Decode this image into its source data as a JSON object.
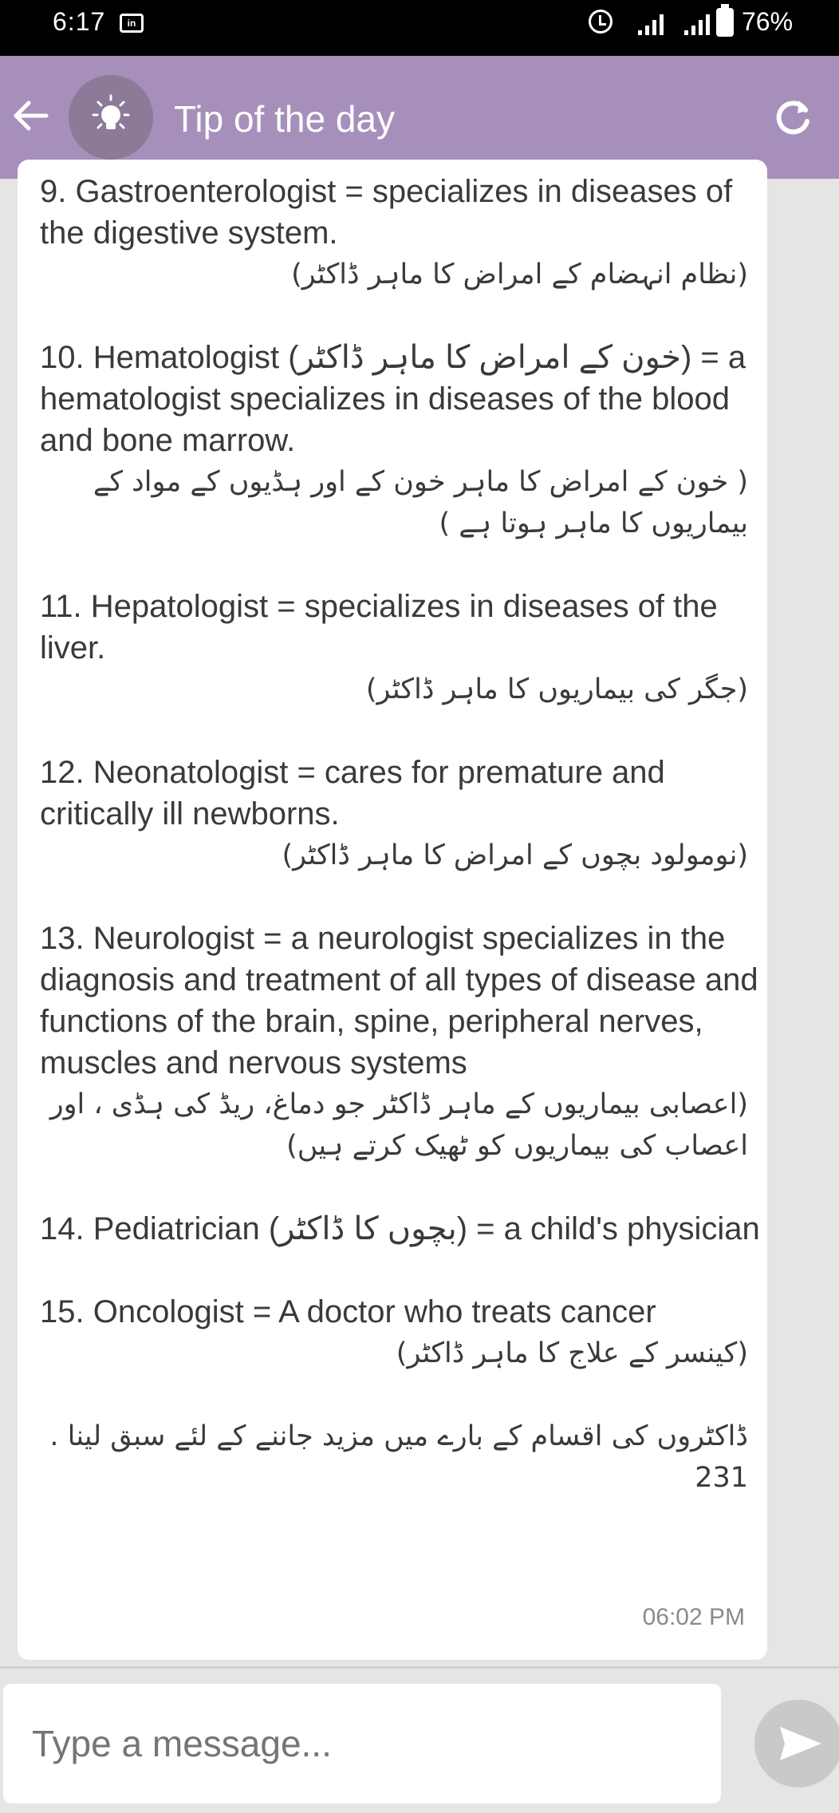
{
  "status_bar": {
    "time": "6:17",
    "battery": "76%",
    "app_icon_text": "in"
  },
  "app_bar": {
    "title": "Tip of the day",
    "back_icon": "arrow-left-icon",
    "avatar_icon": "lightbulb-icon",
    "refresh_icon": "refresh-icon",
    "color": "#a68fba"
  },
  "message": {
    "entries": [
      {
        "en": "9. Gastroenterologist =  specializes in diseases of the digestive system.",
        "ur": "(نظام انہضام کے امراض کا ماہر ڈاکٹر)"
      },
      {
        "en": "10. Hematologist (خون کے امراض کا ماہر ڈاکٹر) = a hematologist specializes in diseases of the blood and bone marrow.",
        "ur": "( خون کے امراض کا ماہر خون کے اور ہڈیوں کے مواد کے بیماریوں کا ماہر ہوتا ہے )"
      },
      {
        "en": "11. Hepatologist = specializes in diseases of the liver.",
        "ur": "(جگر کی بیماریوں کا ماہر ڈاکٹر)"
      },
      {
        "en": "12. Neonatologist = cares for premature and critically ill newborns.",
        "ur": "(نومولود بچوں کے امراض کا ماہر ڈاکٹر)"
      },
      {
        "en": "13. Neurologist = a neurologist specializes in the diagnosis and treatment of all types of disease and functions of the brain, spine, peripheral nerves, muscles and nervous systems",
        "ur": "(اعصابی بیماریوں کے  ماہر ڈاکٹر جو دماغ، ریڈ کی ہڈی ، اور اعصاب کی بیماریوں کو ٹھیک کرتے ہیں)"
      },
      {
        "en": "14. Pediatrician (بچوں کا ڈاکٹر) = a child's physician",
        "ur": ""
      },
      {
        "en": "15. Oncologist = A doctor who treats cancer",
        "ur": "(کینسر کے علاج کا ماہر ڈاکٹر)"
      }
    ],
    "footer": "ڈاکٹروں کی اقسام کے بارے میں مزید جاننے کے لئے سبق لینا . 231",
    "time": "06:02 PM"
  },
  "composer": {
    "placeholder": "Type a message...",
    "send_icon": "send-icon"
  }
}
